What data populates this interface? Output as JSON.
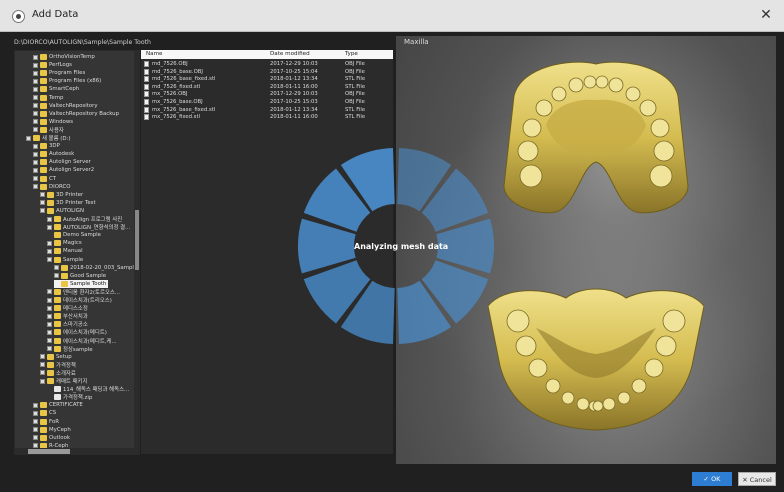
{
  "window": {
    "title": "Add Data"
  },
  "path": "D:\\DIORCO\\AUTOLIGN\\Sample\\Sample Tooth",
  "tree": {
    "items": [
      {
        "label": "OrthoVisionTemp",
        "depth": 2,
        "toggle": true
      },
      {
        "label": "PerfLogs",
        "depth": 2,
        "toggle": true
      },
      {
        "label": "Program Files",
        "depth": 2,
        "toggle": true
      },
      {
        "label": "Program Files (x86)",
        "depth": 2,
        "toggle": true
      },
      {
        "label": "SmartCeph",
        "depth": 2,
        "toggle": true
      },
      {
        "label": "Temp",
        "depth": 2,
        "toggle": true
      },
      {
        "label": "ValtechRepository",
        "depth": 2,
        "toggle": true
      },
      {
        "label": "ValtechRepository Backup",
        "depth": 2,
        "toggle": true
      },
      {
        "label": "Windows",
        "depth": 2,
        "toggle": true
      },
      {
        "label": "사용자",
        "depth": 2,
        "toggle": true
      },
      {
        "label": "새 볼륨 (D:)",
        "depth": 1,
        "toggle": true
      },
      {
        "label": "3DP",
        "depth": 2,
        "toggle": true
      },
      {
        "label": "Autodesk",
        "depth": 2,
        "toggle": true
      },
      {
        "label": "Autolign Server",
        "depth": 2,
        "toggle": true
      },
      {
        "label": "Autolign Server2",
        "depth": 2,
        "toggle": true
      },
      {
        "label": "CT",
        "depth": 2,
        "toggle": true
      },
      {
        "label": "DIORCO",
        "depth": 2,
        "toggle": true
      },
      {
        "label": "3D Printer",
        "depth": 3,
        "toggle": true
      },
      {
        "label": "3D Printer Test",
        "depth": 3,
        "toggle": true
      },
      {
        "label": "AUTOLIGN",
        "depth": 3,
        "toggle": true
      },
      {
        "label": "AutoAlign 프로그램 사진",
        "depth": 4,
        "toggle": true
      },
      {
        "label": "AUTOLIGN_연향석의정 결...",
        "depth": 4,
        "toggle": true
      },
      {
        "label": "Demo Sample",
        "depth": 4,
        "toggle": false
      },
      {
        "label": "Magics",
        "depth": 4,
        "toggle": true
      },
      {
        "label": "Manual",
        "depth": 4,
        "toggle": true
      },
      {
        "label": "Sample",
        "depth": 4,
        "toggle": true
      },
      {
        "label": "2018-02-20_003_Sampl",
        "depth": 5,
        "toggle": true
      },
      {
        "label": "Good Sample",
        "depth": 5,
        "toggle": true
      },
      {
        "label": "Sample Tooth",
        "depth": 5,
        "toggle": false,
        "selected": true
      },
      {
        "label": "덴티움 환자2(토르오스...",
        "depth": 4,
        "toggle": true
      },
      {
        "label": "데이스치과(트리오스)",
        "depth": 4,
        "toggle": true
      },
      {
        "label": "메디스소정",
        "depth": 4,
        "toggle": true
      },
      {
        "label": "부산서치과",
        "depth": 4,
        "toggle": true
      },
      {
        "label": "스마기공소",
        "depth": 4,
        "toggle": true
      },
      {
        "label": "에이스치과(메디트)",
        "depth": 4,
        "toggle": true
      },
      {
        "label": "에이스치과(메디트,케...",
        "depth": 4,
        "toggle": true
      },
      {
        "label": "정상sample",
        "depth": 4,
        "toggle": true
      },
      {
        "label": "Setup",
        "depth": 3,
        "toggle": true
      },
      {
        "label": "가격정책",
        "depth": 3,
        "toggle": true
      },
      {
        "label": "소개자료",
        "depth": 3,
        "toggle": true
      },
      {
        "label": "캐매트 패키지",
        "depth": 3,
        "toggle": true
      },
      {
        "label": "114_해독스 패딩과 해독스...",
        "depth": 4,
        "toggle": false,
        "file": true
      },
      {
        "label": "가격정책.zip",
        "depth": 4,
        "toggle": false,
        "file": true
      },
      {
        "label": "CERTIFICATE",
        "depth": 2,
        "toggle": true
      },
      {
        "label": "CS",
        "depth": 2,
        "toggle": true
      },
      {
        "label": "FoR",
        "depth": 2,
        "toggle": true
      },
      {
        "label": "MyCeph",
        "depth": 2,
        "toggle": true
      },
      {
        "label": "Outlook",
        "depth": 2,
        "toggle": true
      },
      {
        "label": "R-Ceph",
        "depth": 2,
        "toggle": true
      }
    ]
  },
  "files": {
    "columns": [
      "Name",
      "Date modified",
      "Type"
    ],
    "rows": [
      {
        "name": "md_7526.OBJ",
        "date": "2017-12-29 10:03",
        "type": "OBJ File"
      },
      {
        "name": "md_7526_base.OBJ",
        "date": "2017-10-25 15:04",
        "type": "OBJ File"
      },
      {
        "name": "md_7526_base_fixed.stl",
        "date": "2018-01-12 13:34",
        "type": "STL File"
      },
      {
        "name": "md_7526_fixed.stl",
        "date": "2018-01-11 16:00",
        "type": "STL File"
      },
      {
        "name": "mx_7526.OBJ",
        "date": "2017-12-29 10:03",
        "type": "OBJ File"
      },
      {
        "name": "mx_7526_base.OBJ",
        "date": "2017-10-25 15:03",
        "type": "OBJ File"
      },
      {
        "name": "mx_7526_base_fixed.stl",
        "date": "2018-01-12 13:34",
        "type": "STL File"
      },
      {
        "name": "mx_7526_fixed.stl",
        "date": "2018-01-11 16:00",
        "type": "STL File"
      }
    ]
  },
  "viewer": {
    "label": "Maxilla",
    "status": "Analyzing mesh data"
  },
  "buttons": {
    "ok": "OK",
    "cancel": "Cancel"
  },
  "colors": {
    "accent": "#2d7dd2",
    "spinner": "#4a8fd0",
    "folder": "#e9c545",
    "tooth": "#d9c25a"
  }
}
